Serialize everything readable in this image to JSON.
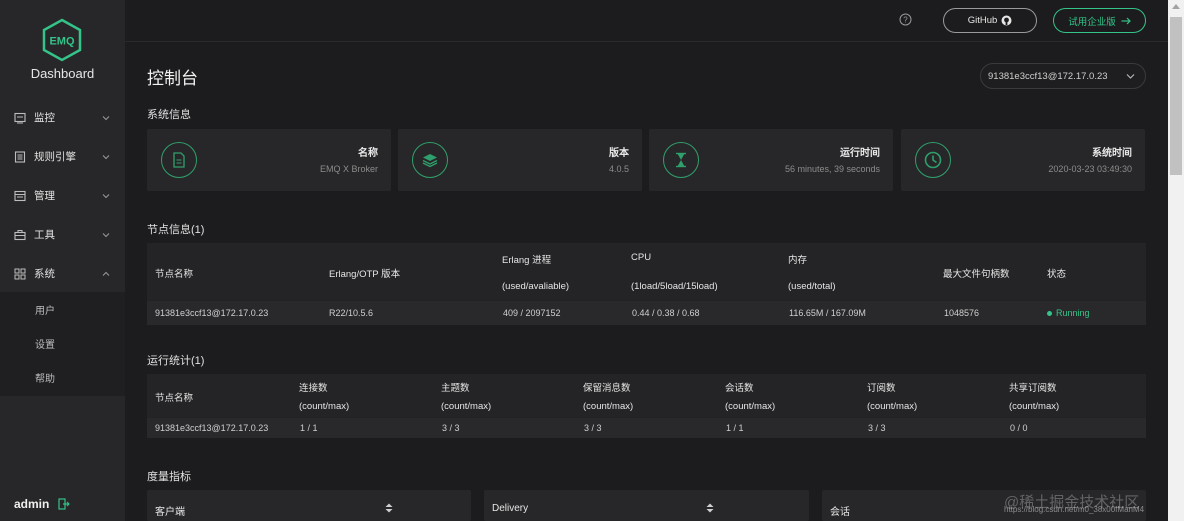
{
  "sidebar": {
    "logo_text": "EMQ",
    "title": "Dashboard",
    "menu": [
      {
        "label": "监控"
      },
      {
        "label": "规则引擎"
      },
      {
        "label": "管理"
      },
      {
        "label": "工具"
      },
      {
        "label": "系统"
      }
    ],
    "submenu": [
      {
        "label": "用户"
      },
      {
        "label": "设置"
      },
      {
        "label": "帮助"
      }
    ],
    "user": "admin"
  },
  "topbar": {
    "github_label": "GitHub",
    "enterprise_label": "试用企业版"
  },
  "main": {
    "title": "控制台",
    "node_select": "91381e3ccf13@172.17.0.23",
    "system_section": "系统信息",
    "cards": [
      {
        "label": "名称",
        "value": "EMQ X Broker",
        "icon": "file-icon"
      },
      {
        "label": "版本",
        "value": "4.0.5",
        "icon": "layers-icon"
      },
      {
        "label": "运行时间",
        "value": "56 minutes, 39 seconds",
        "icon": "hourglass-icon"
      },
      {
        "label": "系统时间",
        "value": "2020-03-23 03:49:30",
        "icon": "clock-icon"
      }
    ],
    "node_section": "节点信息(1)",
    "node_table": {
      "headers": {
        "name": "节点名称",
        "otp": "Erlang/OTP 版本",
        "proc": "Erlang 进程",
        "proc_sub": "(used/avaliable)",
        "cpu": "CPU",
        "cpu_sub": "(1load/5load/15load)",
        "mem": "内存",
        "mem_sub": "(used/total)",
        "fd": "最大文件句柄数",
        "status": "状态"
      },
      "row": {
        "name": "91381e3ccf13@172.17.0.23",
        "otp": "R22/10.5.6",
        "proc": "409 / 2097152",
        "cpu": "0.44 / 0.38 / 0.68",
        "mem": "116.65M / 167.09M",
        "fd": "1048576",
        "status": "Running"
      }
    },
    "stats_section": "运行统计(1)",
    "stats_table": {
      "headers": {
        "name": "节点名称",
        "conn": "连接数",
        "topics": "主题数",
        "retained": "保留消息数",
        "sessions": "会话数",
        "subs": "订阅数",
        "shared": "共享订阅数",
        "sub": "(count/max)"
      },
      "row": {
        "name": "91381e3ccf13@172.17.0.23",
        "conn": "1 / 1",
        "topics": "3 / 3",
        "retained": "3 / 3",
        "sessions": "1 / 1",
        "subs": "3 / 3",
        "shared": "0 / 0"
      }
    },
    "metrics_section": "度量指标",
    "metric_cards": [
      {
        "label": "客户端"
      },
      {
        "label": "Delivery"
      },
      {
        "label": "会话"
      }
    ]
  },
  "watermark": {
    "text": "@稀土掘金技术社区",
    "url": "https://blog.csdn.net/m0_38x00IManM4"
  },
  "colors": {
    "accent": "#34c388",
    "sidebar_bg": "#272729",
    "page_bg": "#1c1c1e"
  }
}
